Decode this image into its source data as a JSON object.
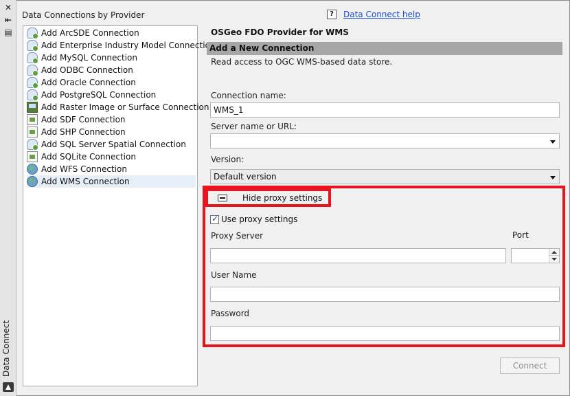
{
  "palette": {
    "title": "Data Connect",
    "icons": [
      "close-icon",
      "dock-icon",
      "properties-icon",
      "autocad-logo-icon"
    ]
  },
  "list": {
    "title": "Data Connections by Provider",
    "items": [
      {
        "label": "Add ArcSDE Connection",
        "icon": "database-icon"
      },
      {
        "label": "Add Enterprise Industry Model Connection",
        "icon": "database-icon"
      },
      {
        "label": "Add MySQL Connection",
        "icon": "database-icon"
      },
      {
        "label": "Add ODBC Connection",
        "icon": "database-icon"
      },
      {
        "label": "Add Oracle Connection",
        "icon": "database-icon"
      },
      {
        "label": "Add PostgreSQL Connection",
        "icon": "database-icon"
      },
      {
        "label": "Add Raster Image or Surface Connection",
        "icon": "raster-icon"
      },
      {
        "label": "Add SDF Connection",
        "icon": "file-icon"
      },
      {
        "label": "Add SHP Connection",
        "icon": "file-icon"
      },
      {
        "label": "Add SQL Server Spatial Connection",
        "icon": "database-icon"
      },
      {
        "label": "Add SQLite Connection",
        "icon": "file-icon"
      },
      {
        "label": "Add WFS Connection",
        "icon": "globe-icon"
      },
      {
        "label": "Add WMS Connection",
        "icon": "globe-icon"
      }
    ],
    "selected_index": 12
  },
  "help": {
    "icon_text": "?",
    "link_text": "Data Connect help"
  },
  "form": {
    "provider_title": "OSGeo FDO Provider for WMS",
    "section_header": "Add a New Connection",
    "description": "Read access to OGC WMS-based data store.",
    "connection_name_label": "Connection name:",
    "connection_name_value": "WMS_1",
    "server_label": "Server name or URL:",
    "server_value": "",
    "version_label": "Version:",
    "version_value": "Default version",
    "proxy_toggle_label": "Hide proxy settings",
    "use_proxy_label": "Use proxy settings",
    "use_proxy_checked": "✓",
    "proxy_server_label": "Proxy Server",
    "proxy_server_value": "",
    "port_label": "Port",
    "port_value": "",
    "user_name_label": "User Name",
    "user_name_value": "",
    "password_label": "Password",
    "password_value": "",
    "connect_button": "Connect"
  },
  "colors": {
    "highlight_border": "#e8141b",
    "section_bar": "#a7a7a7",
    "link": "#1a4fcf"
  }
}
